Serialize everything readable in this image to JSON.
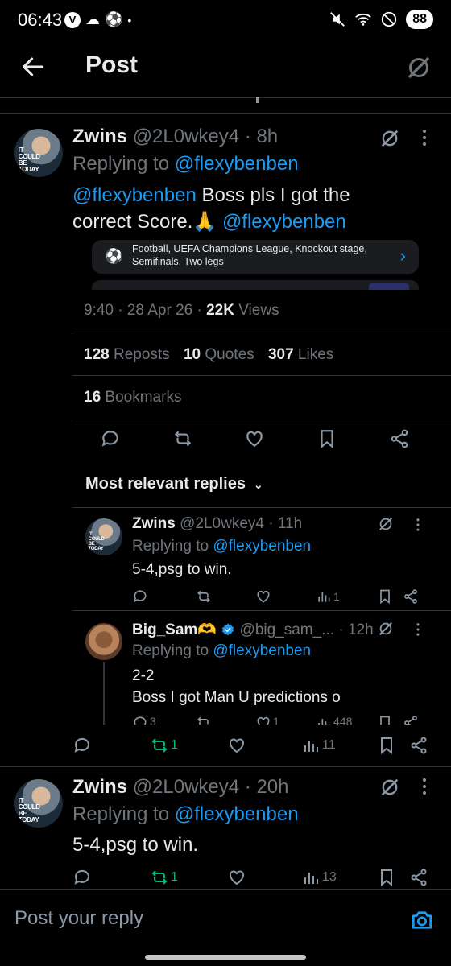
{
  "status_bar": {
    "time": "06:43",
    "battery": "88"
  },
  "header": {
    "title": "Post"
  },
  "main_post": {
    "display_name": "Zwins",
    "handle": "@2L0wkey4",
    "time": "8h",
    "replying_label": "Replying to",
    "replying_to": "@flexybenben",
    "mention": "@flexybenben",
    "text_line1": " Boss pls I got the",
    "text_line2": "correct Score.🙏 ",
    "mention_end": "@flexybenben",
    "avatar_text": "IT COULD BE TODAY",
    "card": {
      "text": "Football, UEFA Champions League, Knockout stage, Semifinals, Two legs"
    },
    "timestamp": "9:40 · 28 Apr 26 · ",
    "views_count": "22K",
    "views_label": " Views",
    "reposts_count": "128",
    "reposts_label": " Reposts",
    "quotes_count": "10",
    "quotes_label": " Quotes",
    "likes_count": "307",
    "likes_label": " Likes",
    "bookmarks_count": "16",
    "bookmarks_label": " Bookmarks"
  },
  "replies_sort": {
    "label": "Most relevant replies"
  },
  "reply1": {
    "display_name": "Zwins",
    "handle": "@2L0wkey4",
    "time": "11h",
    "replying_label": "Replying to",
    "replying_to": "@flexybenben",
    "text": "5-4,psg to win.",
    "views": "1"
  },
  "reply2": {
    "display_name": "Big_Sam🫶",
    "handle": "@big_sam_...",
    "time": "12h",
    "replying_label": "Replying to",
    "replying_to": "@flexybenben",
    "text_line1": "2-2",
    "text_line2": "Boss I got Man U predictions o",
    "replies": "3",
    "likes": "1",
    "views": "448"
  },
  "thread_actions": {
    "reposts": "1",
    "views": "11"
  },
  "reply3": {
    "display_name": "Zwins",
    "handle": "@2L0wkey4",
    "time": "20h",
    "replying_label": "Replying to",
    "replying_to": "@flexybenben",
    "text": "5-4,psg to win.",
    "reposts": "1",
    "views": "13"
  },
  "reply_bar": {
    "placeholder": "Post your reply"
  },
  "colors": {
    "accent": "#1d9bf0",
    "repost_green": "#00ba7c",
    "muted": "#71767b",
    "background": "#000000"
  }
}
